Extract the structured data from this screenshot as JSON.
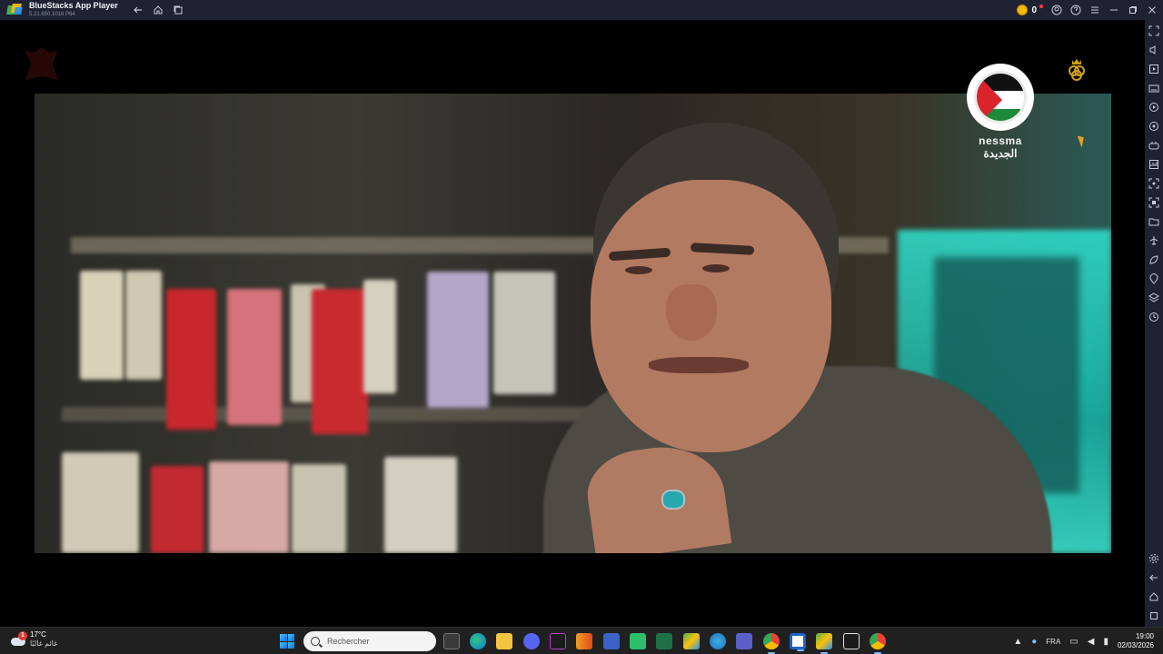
{
  "window": {
    "app_name": "BlueStacks App Player",
    "version": "5.21.650.1016 P64"
  },
  "titlebar": {
    "coins": "0",
    "icons": [
      "back-icon",
      "home-icon",
      "multi-instance-icon",
      "coin-icon",
      "account-icon",
      "help-icon",
      "menu-icon",
      "minimize-icon",
      "restore-icon",
      "close-icon"
    ]
  },
  "sidebar": {
    "icons": [
      "fullscreen-icon",
      "volume-icon",
      "media-icon",
      "keyboard-icon",
      "record-icon",
      "rotate-icon",
      "gamepad-icon",
      "performance-icon",
      "screenshot-icon",
      "screen-record-icon",
      "folder-icon",
      "airplane-icon",
      "eco-icon",
      "location-icon",
      "layers-icon",
      "sync-icon",
      "settings-icon",
      "android-back-icon",
      "android-home-icon",
      "android-recents-icon"
    ]
  },
  "video": {
    "channel_latin": "nessma",
    "channel_arabic": "الجديدة"
  },
  "taskbar": {
    "weather_temp": "17°C",
    "weather_desc": "غائم غالبًا",
    "weather_badge": "1",
    "search_placeholder": "Rechercher",
    "language": "FRA",
    "time": "19:00",
    "date": "02/03/2026"
  }
}
